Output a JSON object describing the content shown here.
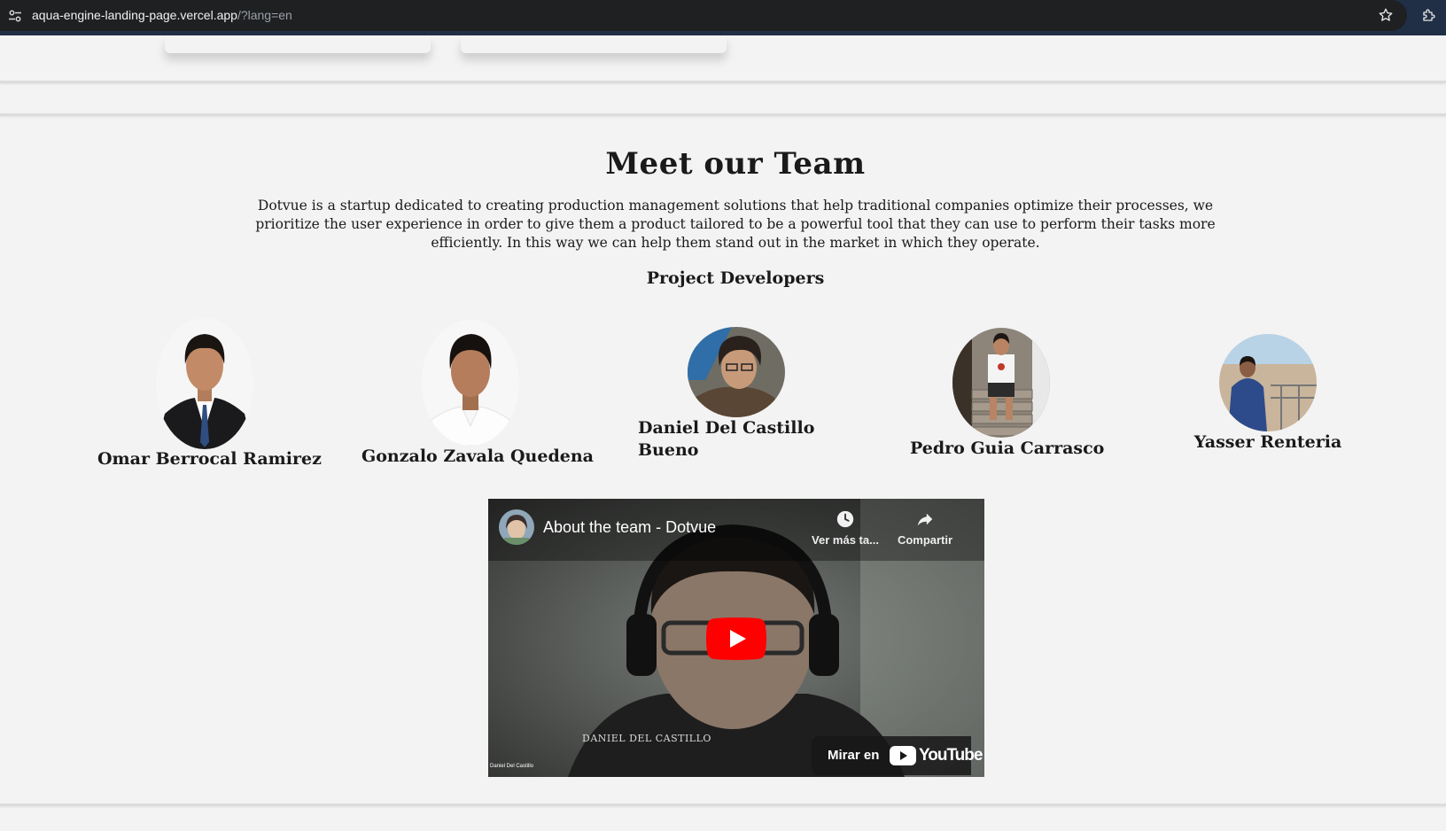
{
  "browser": {
    "url_host": "aqua-engine-landing-page.vercel.app",
    "url_path": "/?lang=en",
    "site_info_icon": "tune-icon",
    "bookmark_icon": "star-icon",
    "extensions_icon": "puzzle-icon"
  },
  "team": {
    "title": "Meet our Team",
    "description": "Dotvue is a startup dedicated to creating production management solutions that help traditional companies optimize their processes, we prioritize the user experience in order to give them a product tailored to be a powerful tool that they can use to perform their tasks more efficiently. In this way we can help them stand out in the market in which they operate.",
    "subtitle": "Project Developers",
    "members": [
      {
        "name": "Omar Berrocal Ramirez"
      },
      {
        "name": "Gonzalo Zavala Quedena"
      },
      {
        "name": "Daniel Del Castillo\nBueno"
      },
      {
        "name": "Pedro Guia Carrasco"
      },
      {
        "name": "Yasser Renteria"
      }
    ]
  },
  "video": {
    "title": "About the team - Dotvue",
    "watch_later": "Ver más ta...",
    "share": "Compartir",
    "watch_on": "Mirar en",
    "youtube": "YouTube",
    "caption": "DANIEL DEL CASTILLO",
    "corner_label": "Daniel Del Castillo",
    "accent_color": "#ff0000"
  }
}
